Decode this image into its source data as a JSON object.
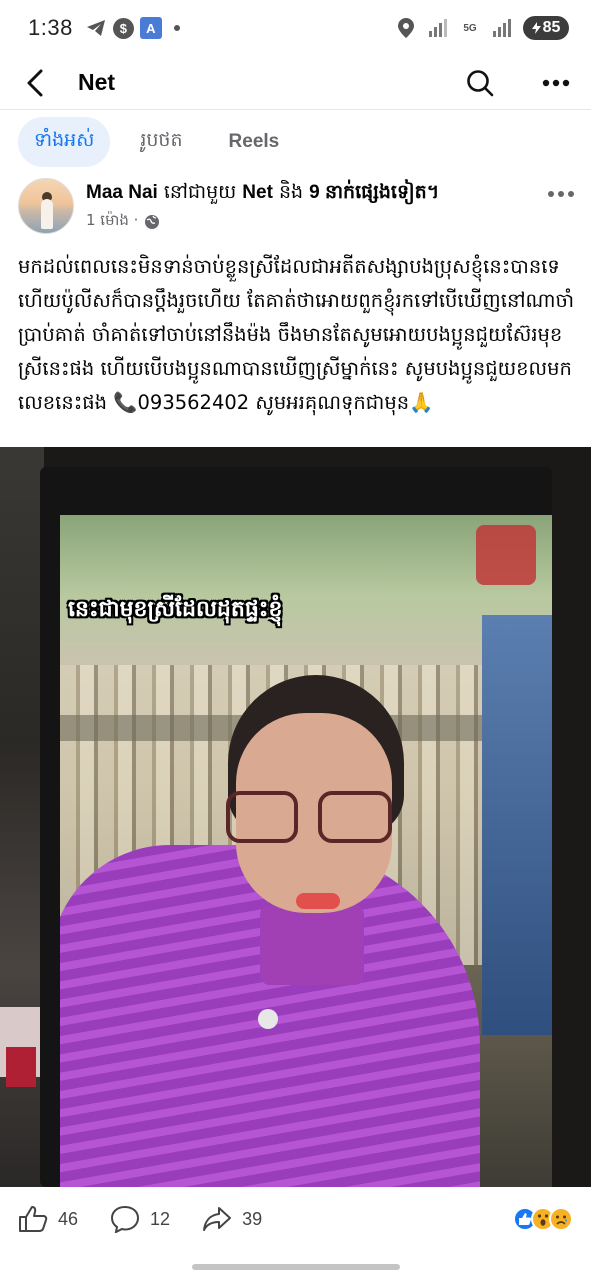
{
  "status_bar": {
    "time": "1:38",
    "battery": "85",
    "network": "5G"
  },
  "header": {
    "title": "Net"
  },
  "tabs": [
    {
      "label": "ទាំងអស់",
      "active": true
    },
    {
      "label": "រូបថត",
      "active": false
    },
    {
      "label": "Reels",
      "active": false
    }
  ],
  "post": {
    "author": "Maa Nai",
    "with_text": "នៅជាមួយ",
    "with_name": "Net",
    "and_text": "និង",
    "others": "9 នាក់ផ្សេងទៀត។",
    "time": "1 ម៉ោង ·",
    "body": "មកដល់ពេលនេះមិនទាន់ចាប់ខ្លួនស្រីដែលជាអតីតសង្សាបងប្រុសខ្ញុំនេះបានទេ ហើយប៉ូលីសក៏បានប្ដឹងរួចហើយ តែគាត់ថាអោយពួកខ្ញុំរកទៅបើឃើញនៅណាចាំប្រាប់គាត់ ចាំគាត់ទៅចាប់នៅនឹងម៉ង ចឹងមានតែសូមអោយបងប្អូនជួយស៊ែរមុខស្រីនេះផង ហើយបើបងប្អូនណាបានឃើញស្រីម្នាក់នេះ សូមបងប្អូនជួយខលមកលេខនេះផង 📞093562402 សូមអរគុណទុកជាមុន🙏",
    "image_caption": "នេះជាមុខស្រីដែលដុតផ្ទះខ្ញុំ"
  },
  "engagement": {
    "likes": "46",
    "comments": "12",
    "shares": "39"
  },
  "colors": {
    "accent": "#1877f2",
    "tab_active_bg": "#e7f0fb",
    "secondary_text": "#65676b"
  }
}
